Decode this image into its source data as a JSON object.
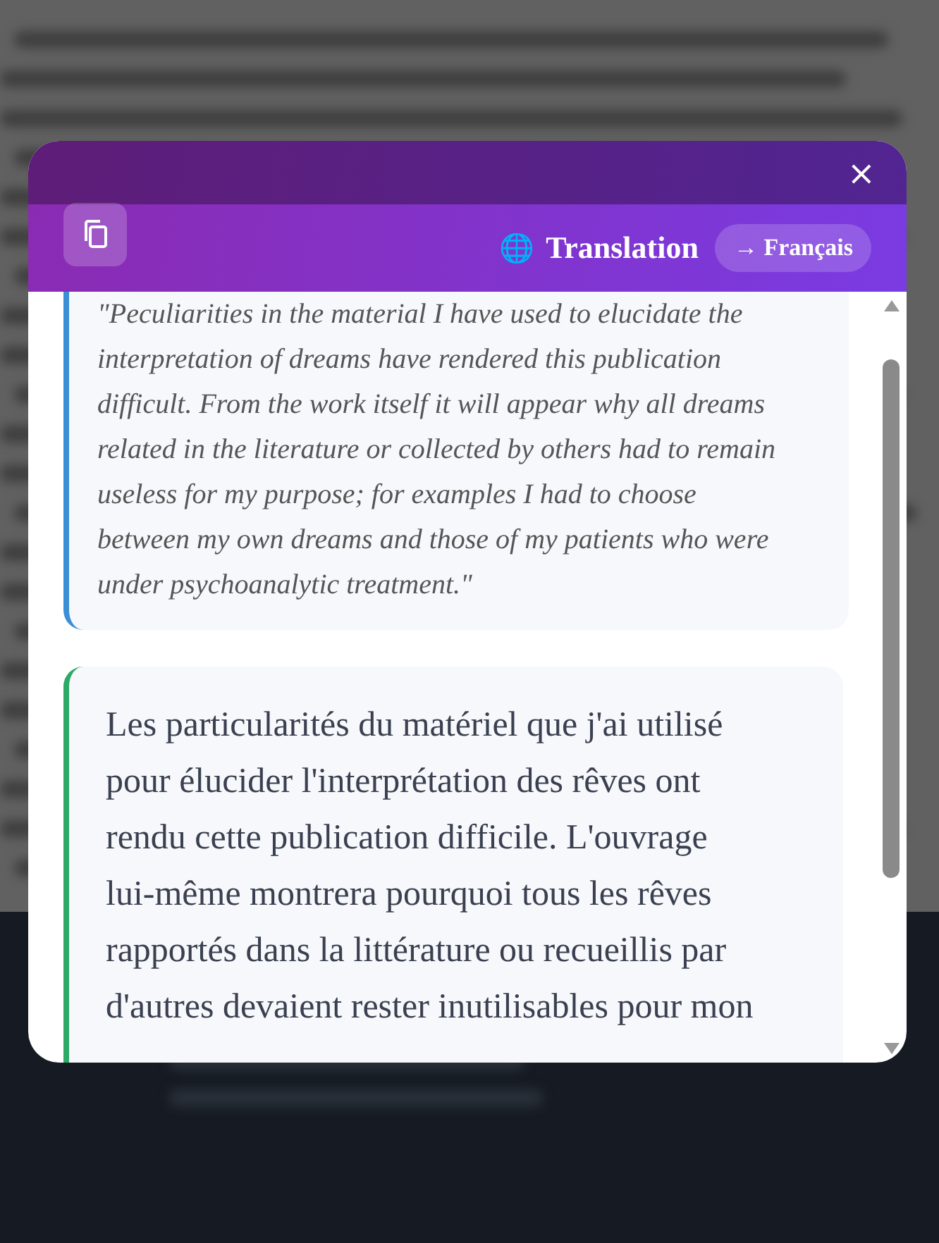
{
  "dialog": {
    "close": "×",
    "copy_button": true,
    "title_icon": "🌐",
    "title": "Translation",
    "target_language": "→ Français"
  },
  "blocks": [
    {
      "kind": "original",
      "text": "\"Peculiarities in the material I have used to elucidate the interpretation of dreams have rendered this publication difficult. From the work itself it will appear why all dreams related in the literature or collected by others had to remain useless for my purpose; for examples I had to choose between my own dreams and those of my patients who were under psychoanalytic treatment.\""
    },
    {
      "kind": "translation",
      "text": "Les particularités du matériel que j'ai utilisé pour élucider l'interprétation des rêves ont rendu cette publication difficile. L'ouvrage lui-même montrera pourquoi tous les rêves rapportés dans la littérature ou recueillis par d'autres devaient rester inutilisables pour mon"
    }
  ]
}
